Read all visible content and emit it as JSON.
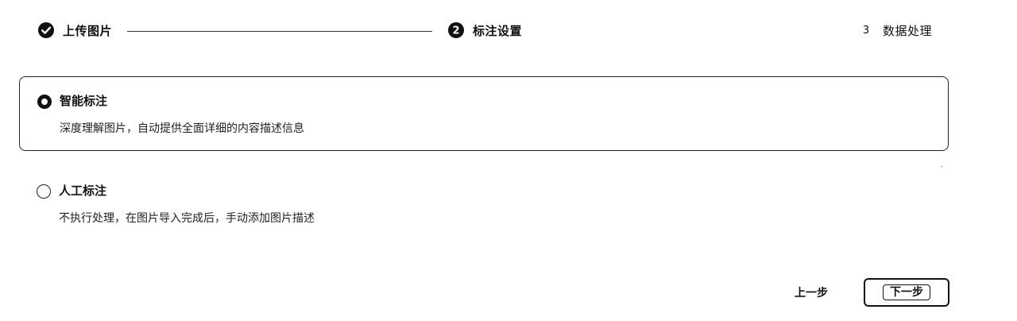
{
  "stepper": {
    "steps": [
      {
        "label": "上传图片",
        "state": "completed",
        "icon": "check-circle-icon"
      },
      {
        "label": "标注设置",
        "state": "current",
        "number": "2",
        "icon": "numbered-circle-icon"
      },
      {
        "label": "数据处理",
        "state": "pending",
        "number": "3"
      }
    ]
  },
  "options": [
    {
      "title": "智能标注",
      "description": "深度理解图片，自动提供全面详细的内容描述信息",
      "selected": true
    },
    {
      "title": "人工标注",
      "description": "不执行处理，在图片导入完成后，手动添加图片描述",
      "selected": false
    }
  ],
  "footer": {
    "prev_label": "上一步",
    "next_label": "下一步"
  },
  "colors": {
    "text": "#111111",
    "border": "#222222",
    "background": "#ffffff"
  }
}
